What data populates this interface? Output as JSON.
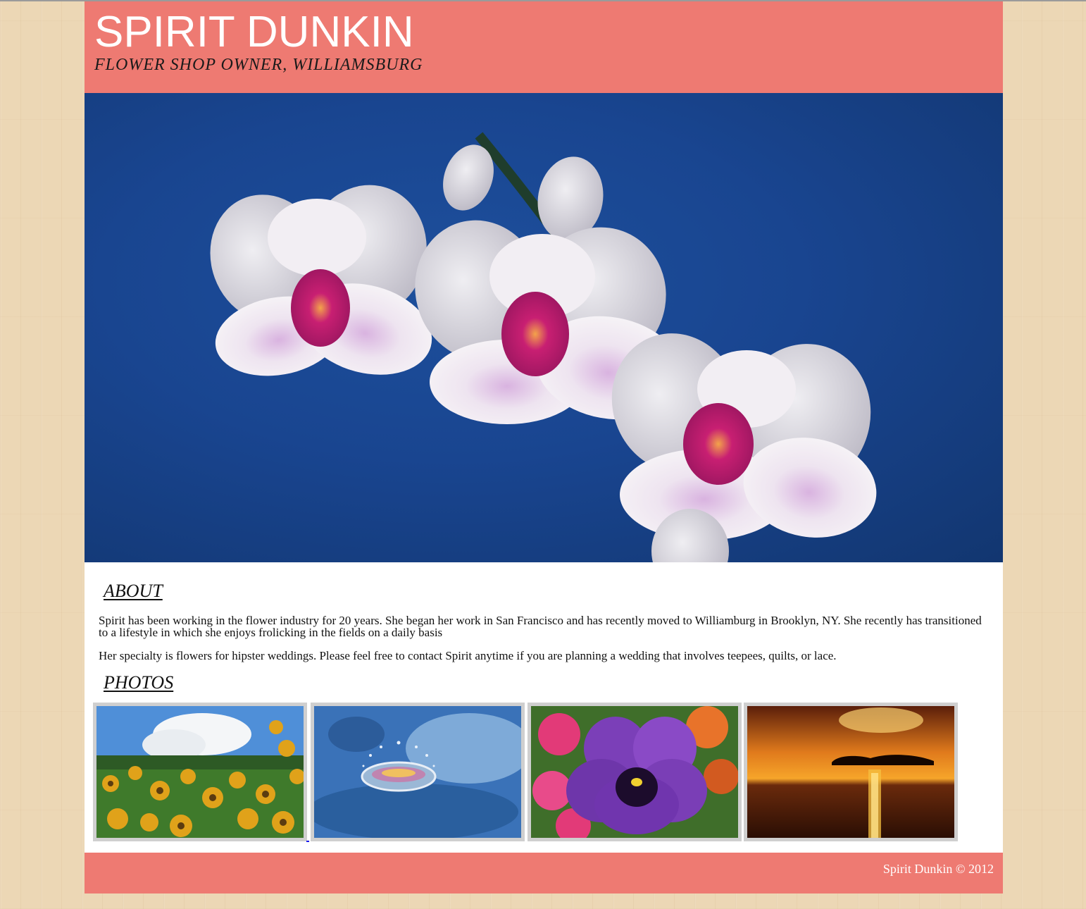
{
  "header": {
    "title": "SPIRIT DUNKIN",
    "subtitle": "FLOWER SHOP OWNER, WILLIAMSBURG"
  },
  "hero": {
    "image_icon": "orchid-photo"
  },
  "about": {
    "heading": "ABOUT",
    "paragraphs": [
      "Spirit has been working in the flower industry for 20 years. She began her work in San Francisco and has recently moved to Williamburg in Brooklyn, NY. She recently has transitioned to a lifestyle in which she enjoys frolicking in the fields on a daily basis",
      "Her specialty is flowers for hipster weddings. Please feel free to contact Spirit anytime if you are planning a wedding that involves teepees, quilts, or lace."
    ]
  },
  "photos": {
    "heading": "PHOTOS",
    "items": [
      {
        "icon": "yellow-flowers-photo"
      },
      {
        "icon": "water-drop-photo"
      },
      {
        "icon": "pansy-photo"
      },
      {
        "icon": "sunset-photo"
      }
    ]
  },
  "footer": {
    "copyright": "Spirit Dunkin © 2012"
  },
  "colors": {
    "accent": "#ee7a72",
    "page_background": "#ecd7b5",
    "content_background": "#ffffff",
    "thumb_border": "#cfcfcf"
  }
}
